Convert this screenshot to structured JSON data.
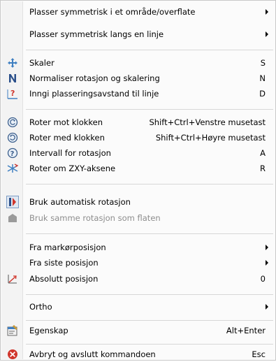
{
  "menu": {
    "items": [
      {
        "label": "Plasser symmetrisk i et område/overflate",
        "shortcut": "",
        "icon": "",
        "submenu": true
      },
      {
        "label": "Plasser symmetrisk langs en linje",
        "shortcut": "",
        "icon": "",
        "submenu": true
      },
      {
        "label": "Skaler",
        "shortcut": "S",
        "icon": "scale-arrows-icon",
        "submenu": false
      },
      {
        "label": "Normaliser rotasjon og skalering",
        "shortcut": "N",
        "icon": "normalize-icon",
        "submenu": false
      },
      {
        "label": "Inngi plasseringsavstand til linje",
        "shortcut": "D",
        "icon": "distance-icon",
        "submenu": false
      },
      {
        "label": "Roter mot klokken",
        "shortcut": "Shift+Ctrl+Venstre musetast",
        "icon": "rotate-ccw-icon",
        "submenu": false
      },
      {
        "label": "Roter med klokken",
        "shortcut": "Shift+Ctrl+Høyre musetast",
        "icon": "rotate-cw-icon",
        "submenu": false
      },
      {
        "label": "Intervall for rotasjon",
        "shortcut": "A",
        "icon": "rotation-interval-icon",
        "submenu": false
      },
      {
        "label": "Roter om ZXY-aksene",
        "shortcut": "R",
        "icon": "rotate-axes-icon",
        "submenu": false
      },
      {
        "label": "Bruk automatisk rotasjon",
        "shortcut": "",
        "icon": "auto-rotation-icon",
        "submenu": false
      },
      {
        "label": "Bruk samme rotasjon som flaten",
        "shortcut": "",
        "icon": "surface-rotation-icon",
        "submenu": false,
        "disabled": true
      },
      {
        "label": "Fra markørposisjon",
        "shortcut": "",
        "icon": "",
        "submenu": true
      },
      {
        "label": "Fra siste posisjon",
        "shortcut": "",
        "icon": "",
        "submenu": true
      },
      {
        "label": "Absolutt posisjon",
        "shortcut": "0",
        "icon": "absolute-position-icon",
        "submenu": false
      },
      {
        "label": "Ortho",
        "shortcut": "",
        "icon": "",
        "submenu": true
      },
      {
        "label": "Egenskap",
        "shortcut": "Alt+Enter",
        "icon": "properties-icon",
        "submenu": false
      },
      {
        "label": "Avbryt og avslutt kommandoen",
        "shortcut": "Esc",
        "icon": "cancel-icon",
        "submenu": false
      }
    ]
  },
  "colors": {
    "blue_icon": "#3f7fc1",
    "navy_icon": "#2a4f8a",
    "red_icon": "#d0352b",
    "grey_icon": "#9a9a9a"
  }
}
